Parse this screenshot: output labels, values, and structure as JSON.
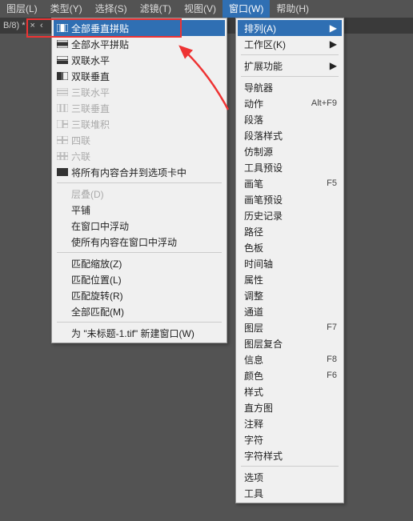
{
  "menubar": {
    "items": [
      {
        "label": "图层(L)"
      },
      {
        "label": "类型(Y)"
      },
      {
        "label": "选择(S)"
      },
      {
        "label": "滤镜(T)"
      },
      {
        "label": "视图(V)"
      },
      {
        "label": "窗口(W)"
      },
      {
        "label": "帮助(H)"
      }
    ],
    "active_index": 5
  },
  "doctab": {
    "label": "B/8) *",
    "close": "×",
    "chev_left": "‹"
  },
  "window_menu": {
    "items": [
      {
        "label": "排列(A)",
        "arrow": "▶",
        "hl": true
      },
      {
        "label": "工作区(K)",
        "arrow": "▶"
      },
      {
        "sep": true
      },
      {
        "label": "扩展功能",
        "arrow": "▶"
      },
      {
        "sep": true
      },
      {
        "label": "导航器"
      },
      {
        "label": "动作",
        "shortcut": "Alt+F9"
      },
      {
        "label": "段落"
      },
      {
        "label": "段落样式"
      },
      {
        "label": "仿制源"
      },
      {
        "label": "工具预设"
      },
      {
        "label": "画笔",
        "shortcut": "F5"
      },
      {
        "label": "画笔预设"
      },
      {
        "label": "历史记录"
      },
      {
        "label": "路径"
      },
      {
        "label": "色板"
      },
      {
        "label": "时间轴"
      },
      {
        "label": "属性"
      },
      {
        "label": "调整"
      },
      {
        "label": "通道"
      },
      {
        "label": "图层",
        "shortcut": "F7"
      },
      {
        "label": "图层复合"
      },
      {
        "label": "信息",
        "shortcut": "F8"
      },
      {
        "label": "颜色",
        "shortcut": "F6"
      },
      {
        "label": "样式"
      },
      {
        "label": "直方图"
      },
      {
        "label": "注释"
      },
      {
        "label": "字符"
      },
      {
        "label": "字符样式"
      },
      {
        "sep": true
      },
      {
        "label": "选项"
      },
      {
        "label": "工具"
      }
    ]
  },
  "arrange_menu": {
    "items": [
      {
        "label": "全部垂直拼贴",
        "icon": "vcols",
        "hl": true
      },
      {
        "label": "全部水平拼贴",
        "icon": "hrows"
      },
      {
        "label": "双联水平",
        "icon": "h2"
      },
      {
        "label": "双联垂直",
        "icon": "v2"
      },
      {
        "label": "三联水平",
        "icon": "h3",
        "disabled": true
      },
      {
        "label": "三联垂直",
        "icon": "v3",
        "disabled": true
      },
      {
        "label": "三联堆积",
        "icon": "s3",
        "disabled": true
      },
      {
        "label": "四联",
        "icon": "g4",
        "disabled": true
      },
      {
        "label": "六联",
        "icon": "g6",
        "disabled": true
      },
      {
        "label": "将所有内容合并到选项卡中",
        "icon": "tab"
      },
      {
        "sep": true
      },
      {
        "label": "层叠(D)",
        "disabled": true
      },
      {
        "label": "平铺"
      },
      {
        "label": "在窗口中浮动"
      },
      {
        "label": "使所有内容在窗口中浮动"
      },
      {
        "sep": true
      },
      {
        "label": "匹配缩放(Z)"
      },
      {
        "label": "匹配位置(L)"
      },
      {
        "label": "匹配旋转(R)"
      },
      {
        "label": "全部匹配(M)"
      },
      {
        "sep": true
      },
      {
        "label": "为 \"未标题-1.tif\" 新建窗口(W)"
      }
    ]
  }
}
